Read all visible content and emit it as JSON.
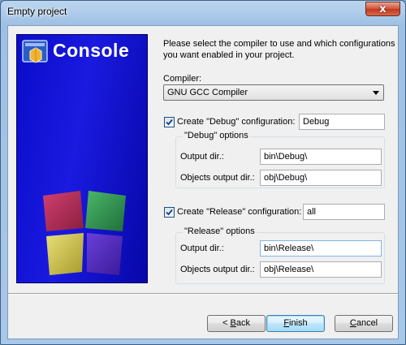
{
  "window": {
    "title": "Empty project",
    "close_glyph": "x"
  },
  "banner": {
    "title": "Console",
    "logo_icon": "code-blocks-logo-icon"
  },
  "compiler": {
    "label": "Compiler:",
    "selected": "GNU GCC Compiler"
  },
  "debug": {
    "checkbox_label": "Create \"Debug\" configuration:",
    "checked": true,
    "name": "Debug",
    "group_label": "\"Debug\" options",
    "output_dir_label": "Output dir.:",
    "output_dir": "bin\\Debug\\",
    "objects_dir_label": "Objects output dir.:",
    "objects_dir": "obj\\Debug\\"
  },
  "release": {
    "checkbox_label": "Create \"Release\" configuration:",
    "checked": true,
    "name": "all",
    "group_label": "\"Release\" options",
    "output_dir_label": "Output dir.:",
    "output_dir": "bin\\Release\\",
    "objects_dir_label": "Objects output dir.:",
    "objects_dir": "obj\\Release\\"
  },
  "description": {
    "line1": "Please select the compiler to use and which configurations",
    "line2": "you want enabled in your project."
  },
  "buttons": {
    "back_prefix": "< ",
    "back_key": "B",
    "back_rest": "ack",
    "finish_key": "F",
    "finish_rest": "inish",
    "cancel_key": "C",
    "cancel_rest": "ancel"
  }
}
